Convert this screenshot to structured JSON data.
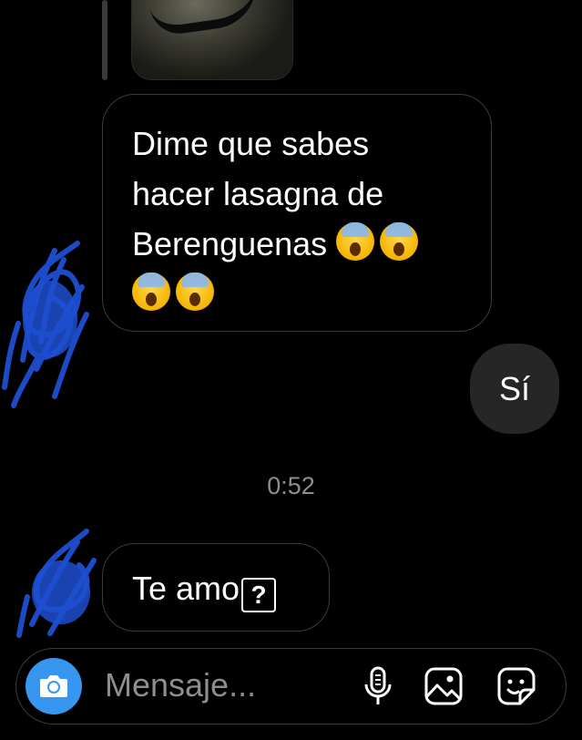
{
  "messages": {
    "received_1": {
      "lines": [
        "Dime que sabes",
        "hacer lasagna de",
        "Berenguenas"
      ],
      "emoji_count": 4,
      "emoji": "face-screaming-in-fear"
    },
    "sent_1": {
      "text": "Sí"
    },
    "timestamp": "0:52",
    "received_2": {
      "text": "Te amo",
      "trailing_glyph": "?"
    }
  },
  "composer": {
    "placeholder": "Mensaje...",
    "icons": [
      "camera-icon",
      "microphone-icon",
      "gallery-icon",
      "sticker-icon"
    ]
  },
  "colors": {
    "background": "#000000",
    "outgoing_bubble": "#262626",
    "incoming_border": "#3b3b3b",
    "camera_button": "#3797f0",
    "timestamp": "#8e8e8e",
    "scribble": "#1f4fd1"
  }
}
